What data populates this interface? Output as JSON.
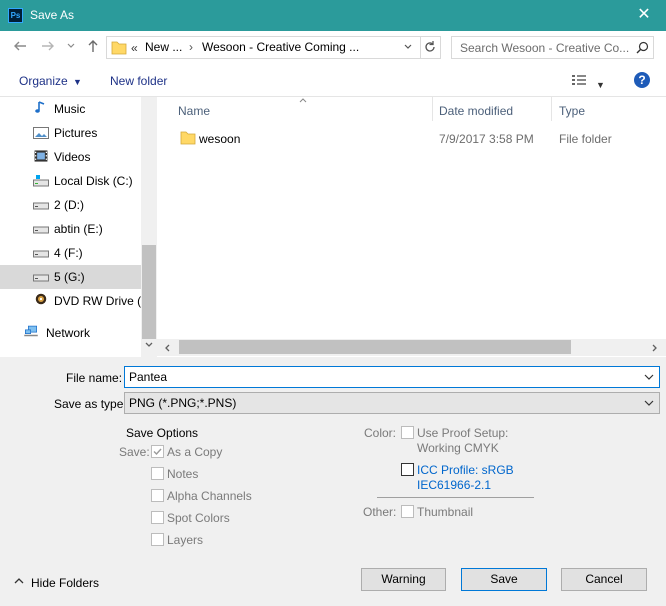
{
  "window": {
    "title": "Save As",
    "app_icon_text": "Ps",
    "close_glyph": "✕"
  },
  "address": {
    "overflow": "«",
    "crumb1": "New ...",
    "crumb2": "Wesoon - Creative Coming ..."
  },
  "search": {
    "placeholder": "Search Wesoon - Creative Co..."
  },
  "commands": {
    "organize": "Organize",
    "new_folder": "New folder"
  },
  "sidebar": {
    "items": [
      {
        "label": "Music",
        "icon": "music-icon"
      },
      {
        "label": "Pictures",
        "icon": "pictures-icon"
      },
      {
        "label": "Videos",
        "icon": "videos-icon"
      },
      {
        "label": "Local Disk (C:)",
        "icon": "local-disk-icon"
      },
      {
        "label": "2 (D:)",
        "icon": "drive-icon"
      },
      {
        "label": "abtin (E:)",
        "icon": "drive-icon"
      },
      {
        "label": "4 (F:)",
        "icon": "drive-icon"
      },
      {
        "label": "5 (G:)",
        "icon": "drive-icon",
        "selected": true
      },
      {
        "label": "DVD RW Drive (J",
        "icon": "dvd-icon"
      },
      {
        "label": "Network",
        "icon": "network-icon"
      }
    ]
  },
  "columns": {
    "name": "Name",
    "date": "Date modified",
    "type": "Type"
  },
  "files": [
    {
      "name": "wesoon",
      "date": "7/9/2017 3:58 PM",
      "type": "File folder"
    }
  ],
  "form": {
    "file_name_label": "File name:",
    "file_name_value": "Pantea",
    "save_type_label": "Save as type:",
    "save_type_value": "PNG (*.PNG;*.PNS)"
  },
  "save_options": {
    "title": "Save Options",
    "save_label": "Save:",
    "as_a_copy": "As a Copy",
    "notes": "Notes",
    "alpha_channels": "Alpha Channels",
    "spot_colors": "Spot Colors",
    "layers": "Layers",
    "color_label": "Color:",
    "use_proof_line1": "Use Proof Setup:",
    "use_proof_line2": "Working CMYK",
    "icc_line1": "ICC Profile:  sRGB",
    "icc_line2": "IEC61966-2.1",
    "other_label": "Other:",
    "thumbnail": "Thumbnail"
  },
  "footer": {
    "hide_folders": "Hide Folders",
    "warning": "Warning",
    "save": "Save",
    "cancel": "Cancel"
  }
}
